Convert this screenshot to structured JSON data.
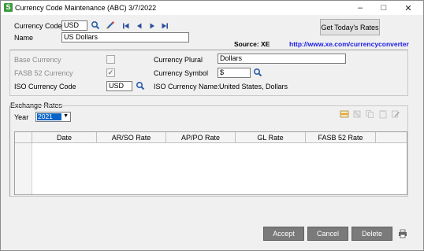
{
  "window": {
    "title": "Currency Code Maintenance (ABC) 3/7/2022",
    "app_icon_letter": "S"
  },
  "header": {
    "currency_code_label": "Currency Code",
    "currency_code_value": "USD",
    "name_label": "Name",
    "name_value": "US Dollars",
    "get_rates_label": "Get Today's Rates",
    "source_text": "Source: XE",
    "source_url": "http://www.xe.com/currencyconverter"
  },
  "details": {
    "base_currency_label": "Base Currency",
    "base_currency_checked": false,
    "fasb_label": "FASB 52 Currency",
    "fasb_checked": true,
    "iso_code_label": "ISO Currency Code",
    "iso_code_value": "USD",
    "plural_label": "Currency Plural",
    "plural_value": "Dollars",
    "symbol_label": "Currency Symbol",
    "symbol_value": "$",
    "iso_name_label": "ISO Currency Name:",
    "iso_name_value": "United States, Dollars"
  },
  "exchange": {
    "section_label": "Exchange Rates",
    "year_label": "Year",
    "year_value": "2021",
    "columns": [
      "Date",
      "AR/SO Rate",
      "AP/PO Rate",
      "GL Rate",
      "FASB 52 Rate"
    ]
  },
  "footer": {
    "accept_label": "Accept",
    "cancel_label": "Cancel",
    "delete_label": "Delete"
  },
  "colors": {
    "url": "#1a1ae6",
    "selection": "#0a64c8",
    "footer_button": "#7a7a7a"
  }
}
